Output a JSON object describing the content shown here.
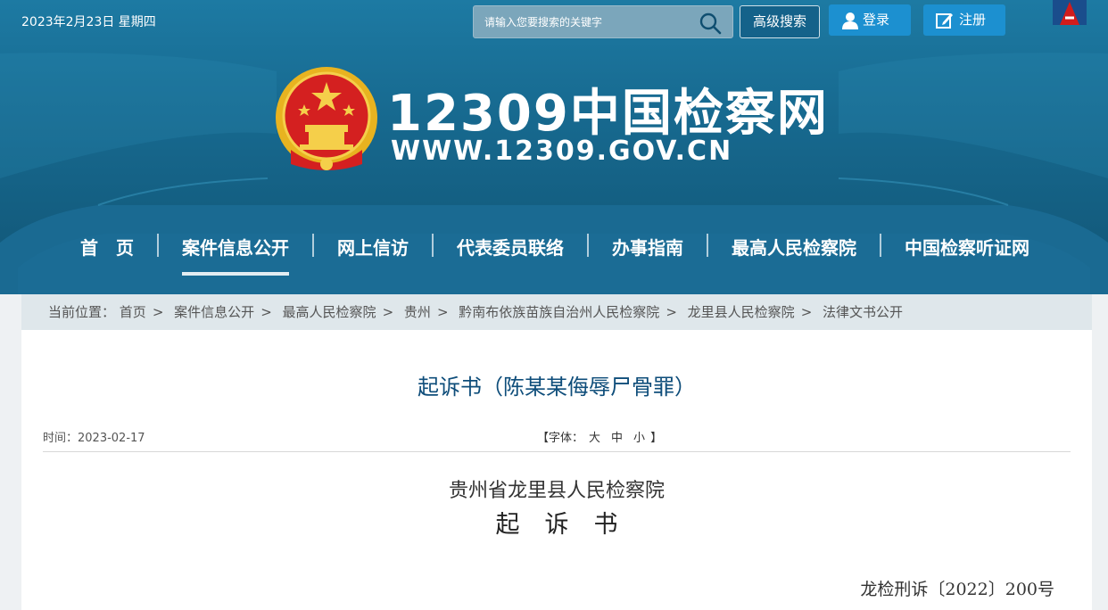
{
  "topbar": {
    "date": "2023年2月23日 星期四",
    "search_placeholder": "请输入您要搜索的关键字",
    "advanced_search": "高级搜索",
    "login": "登录",
    "register": "注册"
  },
  "brand": {
    "title": "12309中国检察网",
    "url": "WWW.12309.GOV.CN"
  },
  "nav": {
    "items": [
      "首　页",
      "案件信息公开",
      "网上信访",
      "代表委员联络",
      "办事指南",
      "最高人民检察院",
      "中国检察听证网"
    ],
    "active_index": 1
  },
  "breadcrumb": {
    "prefix": "当前位置：",
    "items": [
      "首页",
      "案件信息公开",
      "最高人民检察院",
      "贵州",
      "黔南布依族苗族自治州人民检察院",
      "龙里县人民检察院",
      "法律文书公开"
    ]
  },
  "article": {
    "title": "起诉书（陈某某侮辱尸骨罪）",
    "time": "时间：2023-02-17",
    "font_label_open": "【字体：",
    "font_sizes": [
      "大",
      "中",
      "小"
    ],
    "font_label_close": "】",
    "org": "贵州省龙里县人民检察院",
    "doc_type": "起诉书",
    "doc_no": "龙检刑诉〔2022〕200号"
  },
  "colors": {
    "header_blue": "#17698f",
    "title_blue": "#0e4d7a",
    "button_blue": "#1c90d0"
  }
}
